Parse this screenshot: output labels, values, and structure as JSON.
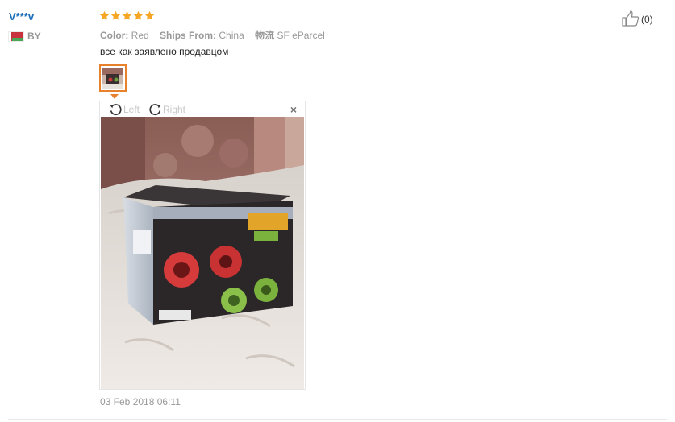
{
  "review": {
    "user_name": "V***v",
    "country_code": "BY",
    "rating": 5,
    "color_label": "Color:",
    "color_value": "Red",
    "ships_label": "Ships From:",
    "ships_value": "China",
    "logistics_label": "物流",
    "logistics_value": "SF eParcel",
    "text": "все как заявлено продавцом",
    "date": "03 Feb 2018 06:11",
    "helpful_count": "(0)"
  },
  "viewer": {
    "rotate_left_label": "Left",
    "rotate_right_label": "Right",
    "close_label": "×"
  },
  "icons": {
    "star": "star-icon",
    "thumb_up": "thumbs-up-icon",
    "rotate_left": "rotate-left-icon",
    "rotate_right": "rotate-right-icon",
    "close": "close-icon",
    "flag": "belarus-flag-icon"
  },
  "colors": {
    "username": "#1d6fb8",
    "star": "#f5a623",
    "thumb_border": "#e8812b",
    "muted_text": "#999999"
  }
}
